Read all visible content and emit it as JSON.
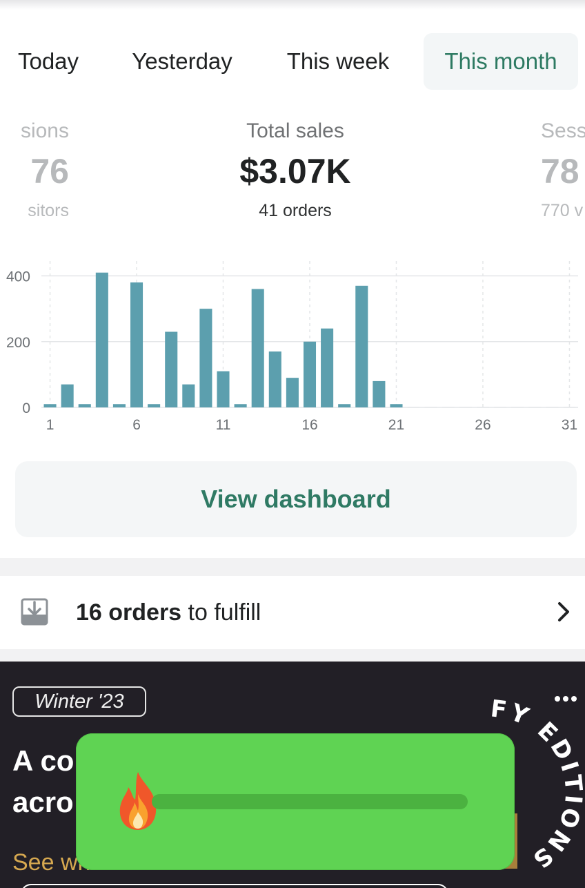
{
  "tabs": [
    {
      "label": "Today",
      "active": false
    },
    {
      "label": "Yesterday",
      "active": false
    },
    {
      "label": "This week",
      "active": false
    },
    {
      "label": "This month",
      "active": true
    }
  ],
  "metrics": {
    "left": {
      "label": "sions",
      "value": "76",
      "sub": "sitors"
    },
    "center": {
      "label": "Total sales",
      "value": "$3.07K",
      "sub": "41 orders"
    },
    "right": {
      "label": "Sess",
      "value": "78",
      "sub": "770 v"
    }
  },
  "chart_data": {
    "type": "bar",
    "categories": [
      "1",
      "2",
      "3",
      "4",
      "5",
      "6",
      "7",
      "8",
      "9",
      "10",
      "11",
      "12",
      "13",
      "14",
      "15",
      "16",
      "17",
      "18",
      "19",
      "20",
      "21",
      "22",
      "23",
      "24",
      "25",
      "26",
      "27",
      "28",
      "29",
      "30",
      "31"
    ],
    "values": [
      10,
      70,
      10,
      410,
      10,
      380,
      10,
      230,
      70,
      300,
      110,
      10,
      360,
      170,
      90,
      200,
      240,
      10,
      370,
      80,
      10,
      0,
      0,
      0,
      0,
      0,
      0,
      0,
      0,
      0,
      0
    ],
    "xticks": [
      "1",
      "6",
      "11",
      "16",
      "21",
      "26",
      "31"
    ],
    "yticks": [
      "0",
      "200",
      "400"
    ],
    "ylim": [
      0,
      420
    ],
    "grid": true,
    "colors": {
      "bar": "#5c9fae",
      "grid": "#e4e6e8",
      "tick": "#6d7175"
    }
  },
  "view_dashboard": {
    "label": "View dashboard"
  },
  "orders": {
    "count_text": "16 orders",
    "rest_text": " to fulfill"
  },
  "promo": {
    "season": "Winter '23",
    "headline1": "A co",
    "headline2": "acro",
    "cta": "See wh",
    "badge_text": "FY EDITIONS"
  },
  "overlay": {
    "progress": 0.0
  }
}
